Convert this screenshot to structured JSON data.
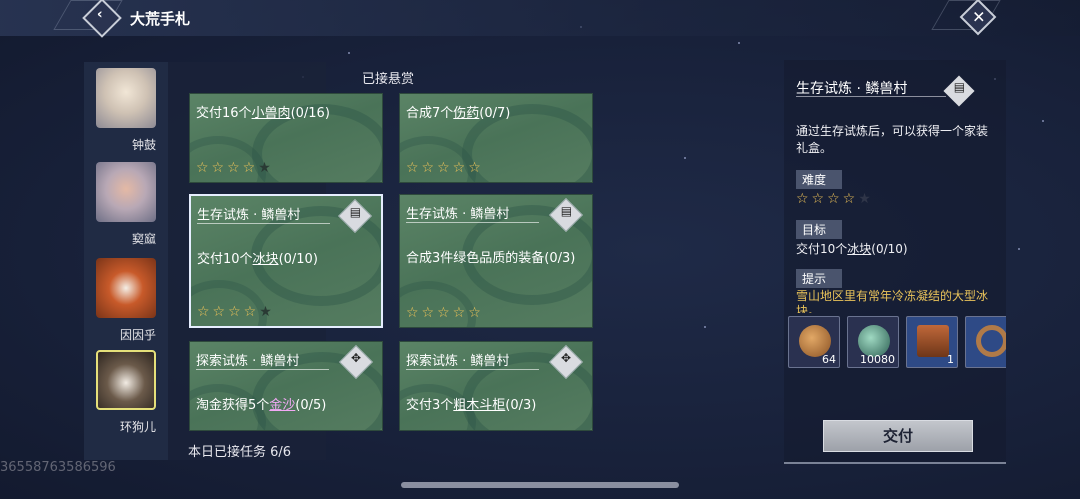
{
  "header": {
    "title": "大荒手札",
    "back_icon": "chevron-left-icon",
    "close_icon": "close-icon"
  },
  "characters": [
    {
      "name": "钟鼓",
      "selected": false
    },
    {
      "name": "窫窳",
      "selected": false
    },
    {
      "name": "因因乎",
      "selected": false
    },
    {
      "name": "环狗儿",
      "selected": true
    }
  ],
  "bounties": {
    "accepted_label": "已接悬赏",
    "daily_count": "本日已接任务 6/6",
    "cards": [
      {
        "head": "",
        "pre": "交付16个",
        "link": "小兽肉",
        "post": "(0/16)",
        "stars": 4,
        "max": 5,
        "active": false
      },
      {
        "head": "",
        "pre": "合成7个",
        "link": "伤药",
        "post": "(0/7)",
        "stars": 5,
        "max": 5,
        "active": false
      },
      {
        "head": "生存试炼 · 鳞兽村",
        "pre": "交付10个",
        "link": "冰块",
        "post": "(0/10)",
        "stars": 4,
        "max": 5,
        "active": true
      },
      {
        "head": "生存试炼 · 鳞兽村",
        "pre": "合成3件绿色品质的装备(0/3)",
        "link": "",
        "post": "",
        "stars": 5,
        "max": 5,
        "active": false
      },
      {
        "head": "探索试炼 · 鳞兽村",
        "pre": "淘金获得5个",
        "link": "金沙",
        "post": "(0/5)",
        "stars": 0,
        "max": 0,
        "active": false
      },
      {
        "head": "探索试炼 · 鳞兽村",
        "pre": "交付3个",
        "link": "粗木斗柜",
        "post": "(0/3)",
        "stars": 0,
        "max": 0,
        "active": false
      }
    ]
  },
  "detail": {
    "title": "生存试炼 · 鳞兽村",
    "description": "通过生存试炼后，可以获得一个家装礼盒。",
    "difficulty_label": "难度",
    "difficulty_stars": 4,
    "difficulty_max": 5,
    "goal_label": "目标",
    "goal_pre": "交付10个",
    "goal_link": "冰块",
    "goal_post": "(0/10)",
    "hint_label": "提示",
    "hint_text": "雪山地区里有常年冷冻凝结的大型冰块。",
    "items": [
      {
        "count": "64",
        "icon": "coin-pouch-icon",
        "color": "#b8773a"
      },
      {
        "count": "10080",
        "icon": "jade-coin-icon",
        "color": "#3e7a6a"
      },
      {
        "count": "1",
        "icon": "chest-icon",
        "color": "#a0502a"
      },
      {
        "count": "",
        "icon": "horseshoe-icon",
        "color": "#9a6a40"
      }
    ],
    "submit_label": "交付"
  },
  "watermark": "36558763586596"
}
